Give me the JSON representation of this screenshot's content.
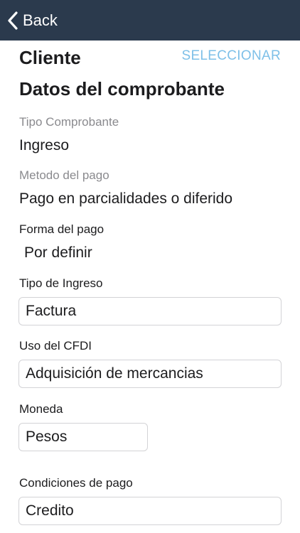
{
  "navbar": {
    "back_label": "Back",
    "background_color": "#2b3a4d"
  },
  "client": {
    "title": "Cliente",
    "select_label": "SELECCIONAR",
    "accent_color": "#7ec0e8"
  },
  "voucher": {
    "title": "Datos del comprobante",
    "tipo_comprobante": {
      "label": "Tipo Comprobante",
      "value": "Ingreso"
    },
    "metodo_pago": {
      "label": "Metodo del pago",
      "value": "Pago en parcialidades o diferido"
    },
    "forma_pago": {
      "label": "Forma del pago",
      "value": "Por definir"
    },
    "tipo_ingreso": {
      "label": "Tipo de Ingreso",
      "value": "Factura"
    },
    "uso_cfdi": {
      "label": "Uso del CFDI",
      "value": "Adquisición de mercancias"
    },
    "moneda": {
      "label": "Moneda",
      "value": "Pesos"
    },
    "condiciones_pago": {
      "label": "Condiciones de pago",
      "value": "Credito"
    }
  }
}
